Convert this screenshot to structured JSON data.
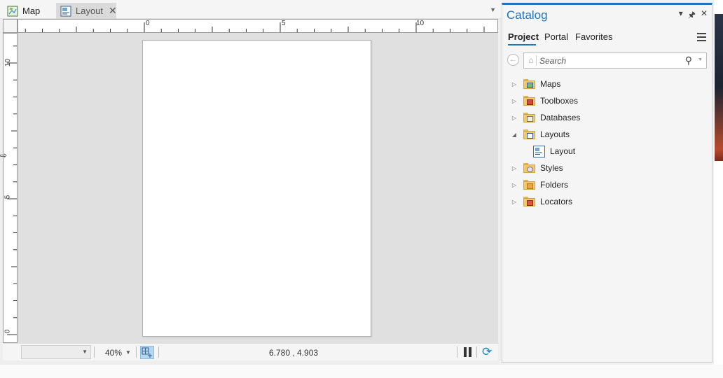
{
  "tabs": [
    {
      "label": "Map",
      "icon": "map-icon",
      "active": false
    },
    {
      "label": "Layout",
      "icon": "layout-icon",
      "active": true
    }
  ],
  "ruler_h_labels": [
    "0",
    "5",
    "10"
  ],
  "ruler_v_labels": [
    "10",
    "5",
    "0"
  ],
  "statusbar": {
    "scale_value": "",
    "zoom": "40%",
    "coordinates": "6.780 , 4.903"
  },
  "catalog": {
    "title": "Catalog",
    "tabs": [
      "Project",
      "Portal",
      "Favorites"
    ],
    "active_tab": "Project",
    "search_placeholder": "Search",
    "items": [
      {
        "label": "Maps",
        "expanded": false,
        "icon": "maps-folder-icon",
        "level": 0
      },
      {
        "label": "Toolboxes",
        "expanded": false,
        "icon": "toolboxes-folder-icon",
        "level": 0
      },
      {
        "label": "Databases",
        "expanded": false,
        "icon": "databases-folder-icon",
        "level": 0
      },
      {
        "label": "Layouts",
        "expanded": true,
        "icon": "layouts-folder-icon",
        "level": 0
      },
      {
        "label": "Layout",
        "expanded": null,
        "icon": "layout-icon",
        "level": 1
      },
      {
        "label": "Styles",
        "expanded": false,
        "icon": "styles-folder-icon",
        "level": 0
      },
      {
        "label": "Folders",
        "expanded": false,
        "icon": "folders-folder-icon",
        "level": 0
      },
      {
        "label": "Locators",
        "expanded": false,
        "icon": "locators-folder-icon",
        "level": 0
      }
    ]
  },
  "colors": {
    "accent": "#1e73be",
    "folder": "#f3c964",
    "canvas": "#e0e0e0",
    "page": "#ffffff"
  }
}
